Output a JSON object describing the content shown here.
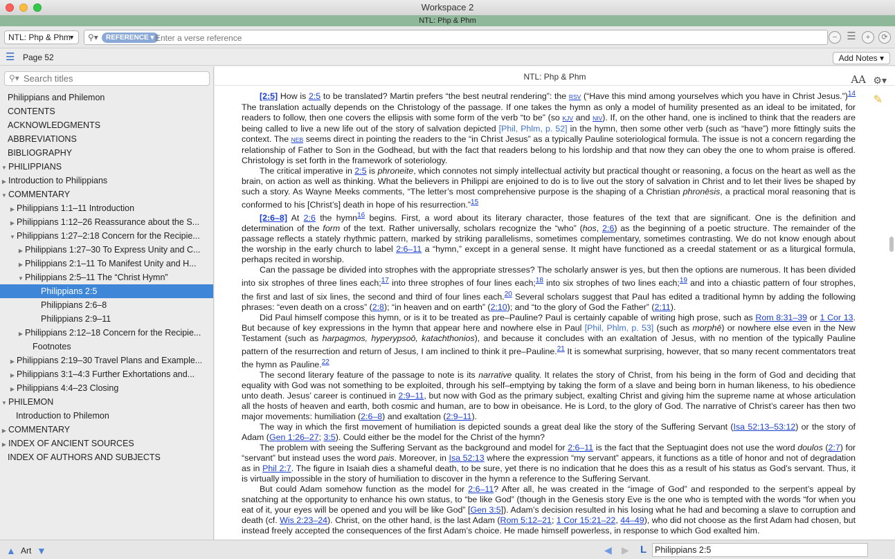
{
  "window": {
    "title": "Workspace 2",
    "subtitle": "NTL: Php & Phm"
  },
  "toolbar": {
    "resource": "NTL: Php & Phm",
    "search_type": "REFERENCE",
    "search_placeholder": "Enter a verse reference"
  },
  "pagebar": {
    "page": "Page 52",
    "add_notes": "Add Notes"
  },
  "sidebar": {
    "search_placeholder": "Search titles",
    "items": [
      {
        "label": "Philippians and Philemon",
        "level": 0,
        "disc": ""
      },
      {
        "label": "CONTENTS",
        "level": 0,
        "disc": ""
      },
      {
        "label": "ACKNOWLEDGMENTS",
        "level": 0,
        "disc": ""
      },
      {
        "label": "ABBREVIATIONS",
        "level": 0,
        "disc": ""
      },
      {
        "label": "BIBLIOGRAPHY",
        "level": 0,
        "disc": ""
      },
      {
        "label": "PHILIPPIANS",
        "level": 0,
        "disc": "open"
      },
      {
        "label": "Introduction to Philippians",
        "level": 1,
        "disc": "closed"
      },
      {
        "label": "COMMENTARY",
        "level": 1,
        "disc": "open"
      },
      {
        "label": "Philippians 1:1–11 Introduction",
        "level": 2,
        "disc": "closed"
      },
      {
        "label": "Philippians 1:12–26 Reassurance about the S...",
        "level": 2,
        "disc": "closed"
      },
      {
        "label": "Philippians 1:27–2:18 Concern for the Recipie...",
        "level": 2,
        "disc": "open"
      },
      {
        "label": "Philippians 1:27–30 To Express Unity and C...",
        "level": 3,
        "disc": "closed"
      },
      {
        "label": "Philippians 2:1–11 To Manifest Unity and H...",
        "level": 3,
        "disc": "closed"
      },
      {
        "label": "Philippians 2:5–11 The “Christ Hymn”",
        "level": 3,
        "disc": "open"
      },
      {
        "label": "Philippians 2:5",
        "level": 4,
        "disc": "",
        "selected": true
      },
      {
        "label": "Philippians 2:6–8",
        "level": 4,
        "disc": ""
      },
      {
        "label": "Philippians 2:9–11",
        "level": 4,
        "disc": ""
      },
      {
        "label": "Philippians 2:12–18 Concern for the Recipie...",
        "level": 3,
        "disc": "closed"
      },
      {
        "label": "Footnotes",
        "level": 3,
        "disc": ""
      },
      {
        "label": "Philippians 2:19–30 Travel Plans and Example...",
        "level": 2,
        "disc": "closed"
      },
      {
        "label": "Philippians 3:1–4:3 Further Exhortations and...",
        "level": 2,
        "disc": "closed"
      },
      {
        "label": "Philippians 4:4–23 Closing",
        "level": 2,
        "disc": "closed"
      },
      {
        "label": "PHILEMON",
        "level": 0,
        "disc": "open"
      },
      {
        "label": "Introduction to Philemon",
        "level": 1,
        "disc": ""
      },
      {
        "label": "COMMENTARY",
        "level": 1,
        "disc": "closed"
      },
      {
        "label": "INDEX OF ANCIENT SOURCES",
        "level": 0,
        "disc": "closed"
      },
      {
        "label": "INDEX OF AUTHORS AND SUBJECTS",
        "level": 0,
        "disc": ""
      }
    ]
  },
  "content": {
    "header": "NTL: Php & Phm",
    "font_size_icon": "AA",
    "paragraphs": [
      [
        {
          "t": "[2:5]",
          "k": "bl"
        },
        {
          "t": " How is "
        },
        {
          "t": "2:5",
          "k": "a"
        },
        {
          "t": " to be translated? Martin prefers “the best neutral rendering”: the "
        },
        {
          "t": "RSV",
          "k": "sc"
        },
        {
          "t": " (“Have this mind among yourselves which you have in Christ Jesus.”)"
        },
        {
          "t": "14",
          "k": "fn"
        },
        {
          "t": " The translation actually depends on the Christology of the passage. If one takes the hymn as only a model of humility presented as an ideal to be imitated, for readers to follow, then one covers the ellipsis with some form of the verb “to be” (so "
        },
        {
          "t": "KJV",
          "k": "sc"
        },
        {
          "t": " and "
        },
        {
          "t": "NIV",
          "k": "sc"
        },
        {
          "t": "). If, on the other hand, one is inclined to think that the readers are being called to live a new life out of the story of salvation depicted "
        },
        {
          "t": "[Phil, Phlm, p. 52]",
          "k": "pg"
        },
        {
          "t": " in the hymn, then some other verb (such as “have”) more fittingly suits the context. The "
        },
        {
          "t": "NEB",
          "k": "sc"
        },
        {
          "t": " seems direct in pointing the readers to the “in Christ Jesus” as a typically Pauline soteriological formula. The issue is not a concern regarding the relationship of Father to Son in the Godhead, but with the fact that readers belong to his lordship and that now they can obey the one to whom praise is offered. Christology is set forth in the framework of soteriology."
        }
      ],
      [
        {
          "t": "The critical imperative in "
        },
        {
          "t": "2:5",
          "k": "a"
        },
        {
          "t": " is "
        },
        {
          "t": "phroneite",
          "k": "i"
        },
        {
          "t": ", which connotes not simply intellectual activity but practical thought or reasoning, a focus on the heart as well as the brain, on action as well as thinking. What the believers in Philippi are enjoined to do is to live out the story of salvation in Christ and to let their lives be shaped by such a story. As Wayne Meeks comments, “The letter’s most comprehensive purpose is the shaping of a Christian "
        },
        {
          "t": "phronēsis",
          "k": "i"
        },
        {
          "t": ", a practical moral reasoning that is conformed to his [Christ’s] death in hope of his resurrection.”"
        },
        {
          "t": "15",
          "k": "fn"
        }
      ],
      [
        {
          "t": "[2:6–8]",
          "k": "bl"
        },
        {
          "t": " At "
        },
        {
          "t": "2:6",
          "k": "a"
        },
        {
          "t": " the hymn"
        },
        {
          "t": "16",
          "k": "fn"
        },
        {
          "t": " begins. First, a word about its literary character, those features of the text that are significant. One is the definition and determination of the "
        },
        {
          "t": "form",
          "k": "i"
        },
        {
          "t": " of the text. Rather universally, scholars recognize the “who” ("
        },
        {
          "t": "hos",
          "k": "i"
        },
        {
          "t": ", "
        },
        {
          "t": "2:6",
          "k": "a"
        },
        {
          "t": ") as the beginning of a poetic structure. The remainder of the passage reflects a stately rhythmic pattern, marked by striking parallelisms, sometimes complementary, sometimes contrasting. We do not know enough about the worship in the early church to label "
        },
        {
          "t": "2:6–11",
          "k": "a"
        },
        {
          "t": " a “hymn,” except in a general sense. It might have functioned as a creedal statement or as a liturgical formula, perhaps recited in worship."
        }
      ],
      [
        {
          "t": "Can the passage be divided into strophes with the appropriate stresses? The scholarly answer is yes, but then the options are numerous. It has been divided into six strophes of three lines each;"
        },
        {
          "t": "17",
          "k": "fn"
        },
        {
          "t": " into three strophes of four lines each;"
        },
        {
          "t": "18",
          "k": "fn"
        },
        {
          "t": " into six strophes of two lines each;"
        },
        {
          "t": "19",
          "k": "fn"
        },
        {
          "t": " and into a chiastic pattern of four strophes, the first and last of six lines, the second and third of four lines each."
        },
        {
          "t": "20",
          "k": "fn"
        },
        {
          "t": " Several scholars suggest that Paul has edited a traditional hymn by adding the following phrases: “even death on a cross” ("
        },
        {
          "t": "2:8",
          "k": "a"
        },
        {
          "t": "); “in heaven and on earth” ("
        },
        {
          "t": "2:10",
          "k": "a"
        },
        {
          "t": "); and “to the glory of God the Father” ("
        },
        {
          "t": "2:11",
          "k": "a"
        },
        {
          "t": ")."
        }
      ],
      [
        {
          "t": "Did Paul himself compose this hymn, or is it to be treated as pre–Pauline? Paul is certainly capable of writing high prose, such as "
        },
        {
          "t": "Rom 8:31–39",
          "k": "a"
        },
        {
          "t": " or "
        },
        {
          "t": "1 Cor 13",
          "k": "a"
        },
        {
          "t": ". But because of key expressions in the hymn that appear here and nowhere else in Paul "
        },
        {
          "t": "[Phil, Phlm, p. 53]",
          "k": "pg"
        },
        {
          "t": " (such as "
        },
        {
          "t": "morphē",
          "k": "i"
        },
        {
          "t": ") or nowhere else even in the New Testament (such as "
        },
        {
          "t": "harpagmos, hyperypsoō, katachthonios",
          "k": "i"
        },
        {
          "t": "), and because it concludes with an exaltation of Jesus, with no mention of the typically Pauline pattern of the resurrection and return of Jesus, I am inclined to think it pre–Pauline."
        },
        {
          "t": "21",
          "k": "fn"
        },
        {
          "t": " It is somewhat surprising, however, that so many recent commentators treat the hymn as Pauline."
        },
        {
          "t": "22",
          "k": "fn"
        }
      ],
      [
        {
          "t": "The second literary feature of the passage to note is its "
        },
        {
          "t": "narrative",
          "k": "i"
        },
        {
          "t": " quality. It relates the story of Christ, from his being in the form of God and deciding that equality with God was not something to be exploited, through his self–emptying by taking the form of a slave and being born in human likeness, to his obedience unto death. Jesus’ career is continued in "
        },
        {
          "t": "2:9–11",
          "k": "a"
        },
        {
          "t": ", but now with God as the primary subject, exalting Christ and giving him the supreme name at whose articulation all the hosts of heaven and earth, both cosmic and human, are to bow in obeisance. He is Lord, to the glory of God. The narrative of Christ’s career has then two major movements: humiliation ("
        },
        {
          "t": "2:6–8",
          "k": "a"
        },
        {
          "t": ") and exaltation ("
        },
        {
          "t": "2:9–11",
          "k": "a"
        },
        {
          "t": ")."
        }
      ],
      [
        {
          "t": "The way in which the first movement of humiliation is depicted sounds a great deal like the story of the Suffering Servant ("
        },
        {
          "t": "Isa 52:13–53:12",
          "k": "a"
        },
        {
          "t": ") or the story of Adam ("
        },
        {
          "t": "Gen 1:26–27",
          "k": "a"
        },
        {
          "t": "; "
        },
        {
          "t": "3:5",
          "k": "a"
        },
        {
          "t": "). Could either be the model for the Christ of the hymn?"
        }
      ],
      [
        {
          "t": "The problem with seeing the Suffering Servant as the background and model for "
        },
        {
          "t": "2:6–11",
          "k": "a"
        },
        {
          "t": " is the fact that the Septuagint does not use the word "
        },
        {
          "t": "doulos",
          "k": "i"
        },
        {
          "t": " ("
        },
        {
          "t": "2:7",
          "k": "a"
        },
        {
          "t": ") for “servant” but instead uses the word "
        },
        {
          "t": "pais",
          "k": "i"
        },
        {
          "t": ". Moreover, in "
        },
        {
          "t": "Isa 52:13",
          "k": "a"
        },
        {
          "t": " where the expression “my servant” appears, it functions as a title of honor and not of degradation as in "
        },
        {
          "t": "Phil 2:7",
          "k": "a"
        },
        {
          "t": ". The figure in Isaiah dies a shameful death, to be sure, yet there is no indication that he does this as a result of his status as God’s servant. Thus, it is virtually impossible in the story of humiliation to discover in the hymn a reference to the Suffering Servant."
        }
      ],
      [
        {
          "t": "But could Adam somehow function as the model for "
        },
        {
          "t": "2:6–11",
          "k": "a"
        },
        {
          "t": "? After all, he was created in the “image of God” and responded to the serpent’s appeal by snatching at the opportunity to enhance his own status, to “be like God” (though in the Genesis story Eve is the one who is tempted with the words “for when you eat of it, your eyes will be opened and you will be like God” ["
        },
        {
          "t": "Gen 3:5",
          "k": "a"
        },
        {
          "t": "]). Adam’s decision resulted in his losing what he had and becoming a slave to corruption and death (cf. "
        },
        {
          "t": "Wis 2:23–24",
          "k": "a"
        },
        {
          "t": "). Christ, on the other hand, is the last Adam ("
        },
        {
          "t": "Rom 5:12–21",
          "k": "a"
        },
        {
          "t": "; "
        },
        {
          "t": "1 Cor 15:21–22",
          "k": "a"
        },
        {
          "t": ", "
        },
        {
          "t": "44–49",
          "k": "a"
        },
        {
          "t": "), who did not choose as the first Adam had chosen, but instead freely accepted the consequences of the first Adam’s choice. He made himself powerless, in response to which God exalted him."
        }
      ]
    ]
  },
  "bottombar": {
    "art_label": "Art",
    "reference": "Philippians 2:5"
  }
}
